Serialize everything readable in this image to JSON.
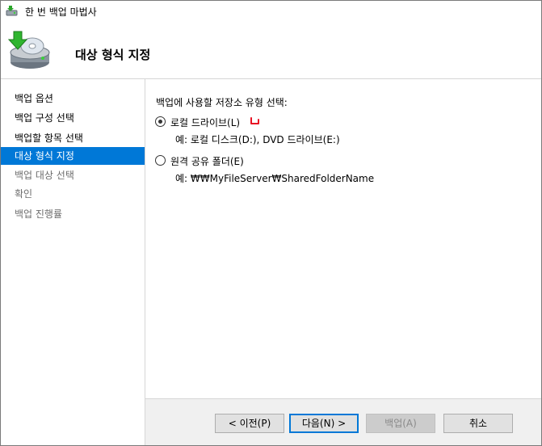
{
  "window": {
    "title": "한 번 백업 마법사"
  },
  "header": {
    "heading": "대상 형식 지정"
  },
  "nav": {
    "items": [
      {
        "label": "백업 옵션",
        "state": "normal"
      },
      {
        "label": "백업 구성 선택",
        "state": "normal"
      },
      {
        "label": "백업할 항목 선택",
        "state": "normal"
      },
      {
        "label": "대상 형식 지정",
        "state": "active"
      },
      {
        "label": "백업 대상 선택",
        "state": "disabled"
      },
      {
        "label": "확인",
        "state": "disabled"
      },
      {
        "label": "백업 진행률",
        "state": "disabled"
      }
    ]
  },
  "content": {
    "prompt": "백업에 사용할 저장소 유형 선택:",
    "options": [
      {
        "label": "로컬 드라이브(L)",
        "example": "예: 로컬 디스크(D:), DVD 드라이브(E:)",
        "selected": true
      },
      {
        "label": "원격 공유 폴더(E)",
        "example": "예: ₩₩MyFileServer₩SharedFolderName",
        "selected": false
      }
    ]
  },
  "footer": {
    "back_label": "< 이전(P)",
    "next_label": "다음(N) >",
    "backup_label": "백업(A)",
    "cancel_label": "취소"
  },
  "colors": {
    "accent": "#0078d7",
    "annotation": "#e81123"
  }
}
